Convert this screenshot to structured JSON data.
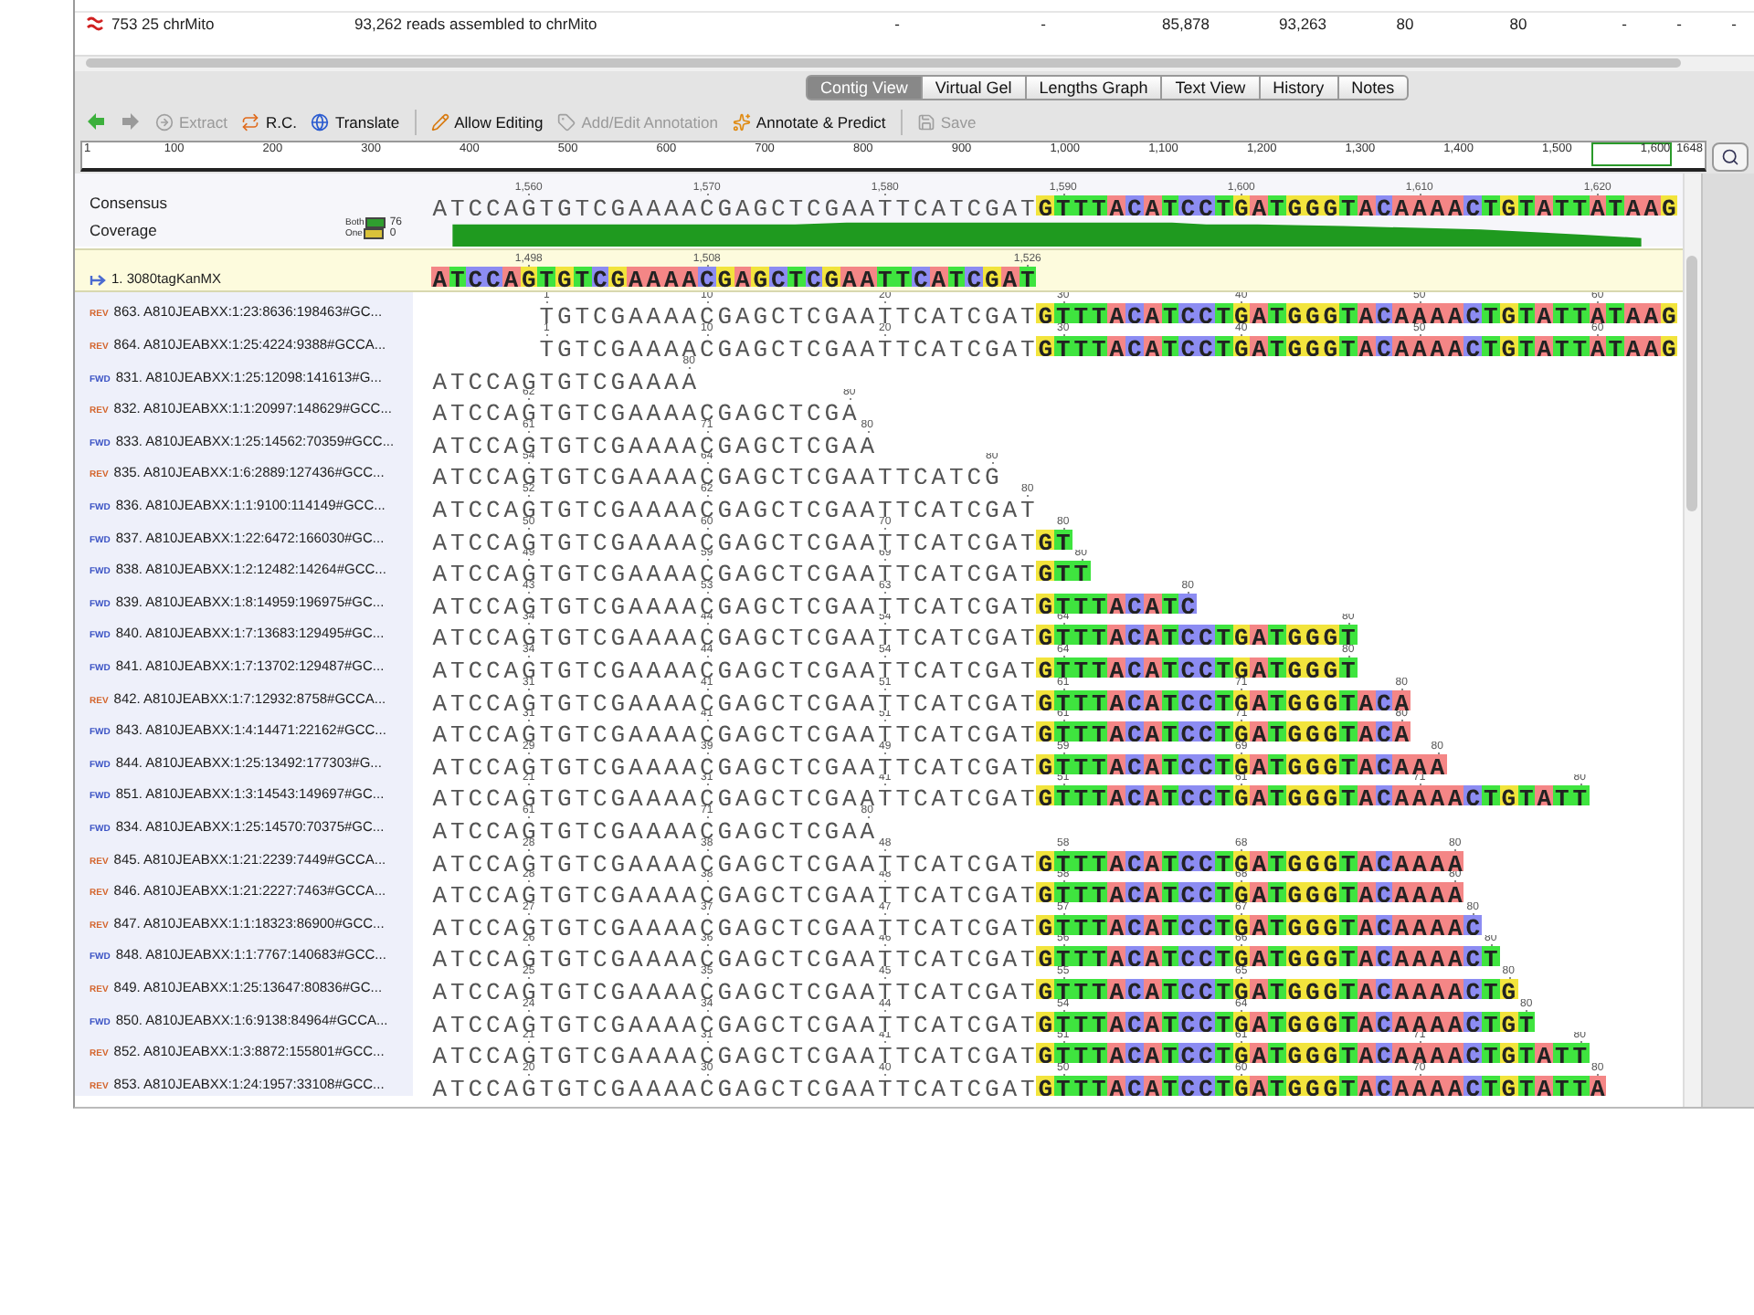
{
  "table_rows": [
    {
      "name": "753 25 chrMito",
      "description": "93,262 reads assembled to chrMito",
      "cells": [
        "-",
        "-",
        "85,878",
        "93,263",
        "80",
        "80",
        "-",
        "-",
        "-"
      ]
    }
  ],
  "tabs": [
    {
      "label": "Contig View",
      "selected": true
    },
    {
      "label": "Virtual Gel",
      "selected": false
    },
    {
      "label": "Lengths Graph",
      "selected": false
    },
    {
      "label": "Text View",
      "selected": false
    },
    {
      "label": "History",
      "selected": false
    },
    {
      "label": "Notes",
      "selected": false
    }
  ],
  "navigation": [
    {
      "disabled": false
    },
    {
      "disabled": true
    }
  ],
  "toolbar_groups": [
    [
      {
        "label": "Extract",
        "disabled": true
      },
      {
        "label": "R.C.",
        "disabled": false
      },
      {
        "label": "Translate",
        "disabled": false
      }
    ],
    [
      {
        "label": "Allow Editing",
        "disabled": false
      },
      {
        "label": "Add/Edit Annotation",
        "disabled": true
      },
      {
        "label": "Annotate & Predict",
        "disabled": false
      }
    ],
    [
      {
        "label": "Save",
        "disabled": true
      }
    ]
  ],
  "ruler": {
    "labels": [
      "1",
      "100",
      "200",
      "300",
      "400",
      "500",
      "600",
      "700",
      "800",
      "900",
      "1,000",
      "1,100",
      "1,200",
      "1,300",
      "1,400",
      "1,500",
      "1,600",
      "1648"
    ]
  },
  "consensus": {
    "label": "Consensus",
    "positions": "      1,560     1,570     1,580     1,590     1,600     1,610     1,620",
    "sequence": " ATCCAGTGTCGAAAACGAGCTCGAATTCATCGAT",
    "extension": "GTTTACATCCTGATGGGTACAAAACTGTATTATAAG"
  },
  "coverage": {
    "label": "Coverage",
    "max": "76",
    "min": "0",
    "legend": [
      {
        "label": "Both",
        "color": "#2f9e2f"
      },
      {
        "label": "One",
        "color": "#d9c23a"
      }
    ]
  },
  "reference": {
    "name": "1. 3080tagKanMX",
    "positions": "      1,498     1,508             1,526",
    "sequence": " ATCCAGTGTCGAAAACGAGCTCGAATTCATCGAT"
  },
  "reads": [
    {
      "strand": "REV",
      "color": "#d4662e",
      "name": "863. A810JEABXX:1:23:8636:198463#GC...",
      "positions": "       1        10        20        30        40        50        60",
      "sequence": "       TGTCGAAAACGAGCTCGAATTCATCGAT",
      "extension": "GTTTACATCCTGATGGGTACAAAACTGTATTATAAG"
    },
    {
      "strand": "REV",
      "color": "#d4662e",
      "name": "864. A810JEABXX:1:25:4224:9388#GCCA...",
      "positions": "       1        10        20        30        40        50        60",
      "sequence": "       TGTCGAAAACGAGCTCGAATTCATCGAT",
      "extension": "GTTTACATCCTGATGGGTACAAAACTGTATTATAAG"
    },
    {
      "strand": "FWD",
      "color": "#3a52c4",
      "name": "831. A810JEABXX:1:25:12098:141613#G...",
      "positions": "               80",
      "sequence": " ATCCAGTGTCGAAAA"
    },
    {
      "strand": "REV",
      "color": "#d4662e",
      "name": "832. A810JEABXX:1:1:20997:148629#GCC...",
      "positions": "      62                80",
      "sequence": " ATCCAGTGTCGAAAACGAGCTCGA"
    },
    {
      "strand": "FWD",
      "color": "#3a52c4",
      "name": "833. A810JEABXX:1:25:14562:70359#GCC...",
      "positions": "      61        71       80",
      "sequence": " ATCCAGTGTCGAAAACGAGCTCGAA"
    },
    {
      "strand": "REV",
      "color": "#d4662e",
      "name": "835. A810JEABXX:1:6:2889:127436#GCC...",
      "positions": "      54        64              80",
      "sequence": " ATCCAGTGTCGAAAACGAGCTCGAATTCATCG"
    },
    {
      "strand": "FWD",
      "color": "#3a52c4",
      "name": "836. A810JEABXX:1:1:9100:114149#GCC...",
      "positions": "      52        62                80",
      "sequence": " ATCCAGTGTCGAAAACGAGCTCGAATTCATCGAT"
    },
    {
      "strand": "FWD",
      "color": "#3a52c4",
      "name": "837. A810JEABXX:1:22:6472:166030#GC...",
      "positions": "      50        60        70        80",
      "sequence": " ATCCAGTGTCGAAAACGAGCTCGAATTCATCGAT",
      "extension": "GT"
    },
    {
      "strand": "FWD",
      "color": "#3a52c4",
      "name": "838. A810JEABXX:1:2:12482:14264#GCC...",
      "positions": "      49        59        69         80",
      "sequence": " ATCCAGTGTCGAAAACGAGCTCGAATTCATCGAT",
      "extension": "GTT"
    },
    {
      "strand": "FWD",
      "color": "#3a52c4",
      "name": "839. A810JEABXX:1:8:14959:196975#GC...",
      "positions": "      43        53        63               80",
      "sequence": " ATCCAGTGTCGAAAACGAGCTCGAATTCATCGAT",
      "extension": "GTTTACATC"
    },
    {
      "strand": "FWD",
      "color": "#3a52c4",
      "name": "840. A810JEABXX:1:7:13683:129495#GC...",
      "positions": "      34        44        54        64              80",
      "sequence": " ATCCAGTGTCGAAAACGAGCTCGAATTCATCGAT",
      "extension": "GTTTACATCCTGATGGGT"
    },
    {
      "strand": "FWD",
      "color": "#3a52c4",
      "name": "841. A810JEABXX:1:7:13702:129487#GC...",
      "positions": "      34        44        54        64              80",
      "sequence": " ATCCAGTGTCGAAAACGAGCTCGAATTCATCGAT",
      "extension": "GTTTACATCCTGATGGGT"
    },
    {
      "strand": "REV",
      "color": "#d4662e",
      "name": "842. A810JEABXX:1:7:12932:8758#GCCA...",
      "positions": "      31        41        51        61        71       80",
      "sequence": " ATCCAGTGTCGAAAACGAGCTCGAATTCATCGAT",
      "extension": "GTTTACATCCTGATGGGTACA"
    },
    {
      "strand": "FWD",
      "color": "#3a52c4",
      "name": "843. A810JEABXX:1:4:14471:22162#GCC...",
      "positions": "      31        41        51        61        71       80",
      "sequence": " ATCCAGTGTCGAAAACGAGCTCGAATTCATCGAT",
      "extension": "GTTTACATCCTGATGGGTACA"
    },
    {
      "strand": "FWD",
      "color": "#3a52c4",
      "name": "844. A810JEABXX:1:25:13492:177303#G...",
      "positions": "      29        39        49        59        69         80",
      "sequence": " ATCCAGTGTCGAAAACGAGCTCGAATTCATCGAT",
      "extension": "GTTTACATCCTGATGGGTACAAA"
    },
    {
      "strand": "FWD",
      "color": "#3a52c4",
      "name": "851. A810JEABXX:1:3:14543:149697#GC...",
      "positions": "      21        31        41        51        61        71       80",
      "sequence": " ATCCAGTGTCGAAAACGAGCTCGAATTCATCGAT",
      "extension": "GTTTACATCCTGATGGGTACAAAACTGTATT"
    },
    {
      "strand": "FWD",
      "color": "#3a52c4",
      "name": "834. A810JEABXX:1:25:14570:70375#GC...",
      "positions": "      61        71       80",
      "sequence": " ATCCAGTGTCGAAAACGAGCTCGAA"
    },
    {
      "strand": "REV",
      "color": "#d4662e",
      "name": "845. A810JEABXX:1:21:2239:7449#GCCA...",
      "positions": "      28        38        48        58        68          80",
      "sequence": " ATCCAGTGTCGAAAACGAGCTCGAATTCATCGAT",
      "extension": "GTTTACATCCTGATGGGTACAAAA"
    },
    {
      "strand": "REV",
      "color": "#d4662e",
      "name": "846. A810JEABXX:1:21:2227:7463#GCCA...",
      "positions": "      28        38        48        58        68          80",
      "sequence": " ATCCAGTGTCGAAAACGAGCTCGAATTCATCGAT",
      "extension": "GTTTACATCCTGATGGGTACAAAA"
    },
    {
      "strand": "REV",
      "color": "#d4662e",
      "name": "847. A810JEABXX:1:1:18323:86900#GCC...",
      "positions": "      27        37        47        57        67           80",
      "sequence": " ATCCAGTGTCGAAAACGAGCTCGAATTCATCGAT",
      "extension": "GTTTACATCCTGATGGGTACAAAAC"
    },
    {
      "strand": "FWD",
      "color": "#3a52c4",
      "name": "848. A810JEABXX:1:1:7767:140683#GCC...",
      "positions": "      26        36        46        56        66            80",
      "sequence": " ATCCAGTGTCGAAAACGAGCTCGAATTCATCGAT",
      "extension": "GTTTACATCCTGATGGGTACAAAACT"
    },
    {
      "strand": "REV",
      "color": "#d4662e",
      "name": "849. A810JEABXX:1:25:13647:80836#GC...",
      "positions": "      25        35        45        55        65             80",
      "sequence": " ATCCAGTGTCGAAAACGAGCTCGAATTCATCGAT",
      "extension": "GTTTACATCCTGATGGGTACAAAACTG"
    },
    {
      "strand": "FWD",
      "color": "#3a52c4",
      "name": "850. A810JEABXX:1:6:9138:84964#GCCA...",
      "positions": "      24        34        44        54        64              80",
      "sequence": " ATCCAGTGTCGAAAACGAGCTCGAATTCATCGAT",
      "extension": "GTTTACATCCTGATGGGTACAAAACTGT"
    },
    {
      "strand": "REV",
      "color": "#d4662e",
      "name": "852. A810JEABXX:1:3:8872:155801#GCC...",
      "positions": "      21        31        41        51        61        71       80",
      "sequence": " ATCCAGTGTCGAAAACGAGCTCGAATTCATCGAT",
      "extension": "GTTTACATCCTGATGGGTACAAAACTGTATT"
    },
    {
      "strand": "REV",
      "color": "#d4662e",
      "name": "853. A810JEABXX:1:24:1957:33108#GCC...",
      "positions": "      20        30        40        50        60        70        80",
      "sequence": " ATCCAGTGTCGAAAACGAGCTCGAATTCATCGAT",
      "extension": "GTTTACATCCTGATGGGTACAAAACTGTATTA"
    }
  ]
}
